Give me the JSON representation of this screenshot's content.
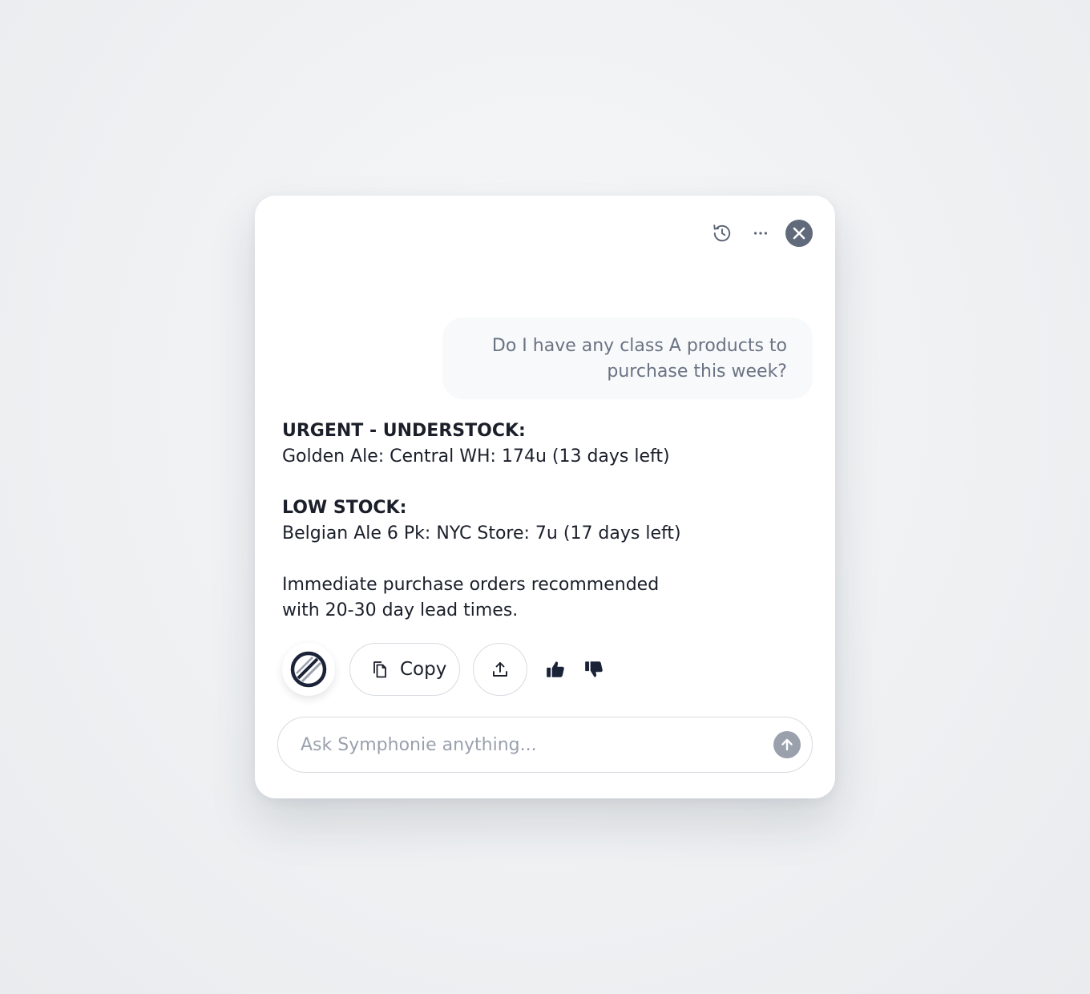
{
  "header": {
    "history_icon": "history-icon",
    "more_icon": "more-horizontal-icon",
    "close_icon": "close-icon"
  },
  "conversation": {
    "user_message": "Do I have any class A products to purchase this week?",
    "assistant": {
      "urgent_heading": "URGENT - UNDERSTOCK:",
      "urgent_item": "Golden Ale: Central WH: 174u (13 days left)",
      "low_heading": "LOW STOCK:",
      "low_item": "Belgian Ale 6 Pk: NYC Store: 7u (17 days left)",
      "recommendation_line1": "Immediate purchase orders recommended",
      "recommendation_line2": "with 20-30 day lead times."
    }
  },
  "actions": {
    "copy_label": "Copy",
    "share_icon": "upload-icon",
    "thumbs_up_icon": "thumbs-up-icon",
    "thumbs_down_icon": "thumbs-down-icon"
  },
  "composer": {
    "placeholder": "Ask Symphonie anything...",
    "value": ""
  },
  "colors": {
    "accent_dark": "#1b2338",
    "close_bg": "#606a7b",
    "send_bg": "#9aa1ad",
    "user_text": "#6a7384"
  }
}
